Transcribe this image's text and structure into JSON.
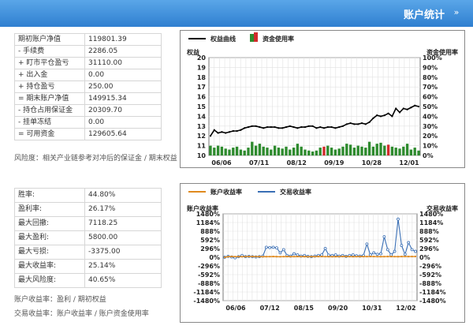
{
  "header": {
    "title": "账户统计",
    "toggle_glyph": "»"
  },
  "account_table": [
    {
      "label": "期初账户净值",
      "value": "119801.39"
    },
    {
      "label": "- 手续费",
      "value": "2286.05"
    },
    {
      "label": "+ 盯市平仓盈亏",
      "value": "31110.00"
    },
    {
      "label": "+ 出入金",
      "value": "0.00"
    },
    {
      "label": "+ 持仓盈亏",
      "value": "250.00"
    },
    {
      "label": "= 期末账户净值",
      "value": "149915.34"
    },
    {
      "label": "- 持仓占用保证金",
      "value": "20309.70"
    },
    {
      "label": "- 挂单冻结",
      "value": "0.00"
    },
    {
      "label": "= 可用资金",
      "value": "129605.64"
    }
  ],
  "risk_note": "风险度：相关产业链参考对冲后的保证金 / 期末权益",
  "performance_table": [
    {
      "label": "胜率:",
      "value": "44.80%"
    },
    {
      "label": "盈利率:",
      "value": "26.17%"
    },
    {
      "label": "最大回撤:",
      "value": "7118.25"
    },
    {
      "label": "最大盈利:",
      "value": "5800.00"
    },
    {
      "label": "最大亏损:",
      "value": "-3375.00"
    },
    {
      "label": "最大收益率:",
      "value": "25.14%"
    },
    {
      "label": "最大风险度:",
      "value": "40.65%"
    }
  ],
  "formula_notes": {
    "account_return": "账户收益率：盈利 / 期初权益",
    "trade_return": "交易收益率：账户收益率 / 账户资金使用率"
  },
  "colors": {
    "equity_line": "#000000",
    "usage_up": "#2e8b2e",
    "usage_down": "#d12c2c",
    "account_line": "#e08a1e",
    "trade_line": "#3a6fb5"
  },
  "chart_data": [
    {
      "type": "line+bar",
      "legend": [
        {
          "name": "权益曲线",
          "icon": "line"
        },
        {
          "name": "资金使用率",
          "icon": "bar-green-red"
        }
      ],
      "left_axis_title": "权益",
      "right_axis_title": "资金使用率",
      "left_ticks": [
        "20",
        "19",
        "18",
        "17",
        "16",
        "15",
        "14",
        "13",
        "12",
        "11",
        "10"
      ],
      "right_ticks": [
        "100%",
        "90%",
        "80%",
        "70%",
        "60%",
        "50%",
        "40%",
        "30%",
        "20%",
        "10%",
        "0%"
      ],
      "x_ticks": [
        "06/06",
        "07/11",
        "08/12",
        "09/19",
        "10/28",
        "12/01"
      ],
      "ylim": [
        10,
        20
      ],
      "equity": [
        12.0,
        12.6,
        12.3,
        12.4,
        12.3,
        12.4,
        12.5,
        12.5,
        12.6,
        12.8,
        12.9,
        13.0,
        13.0,
        12.9,
        12.8,
        12.9,
        12.9,
        12.9,
        12.8,
        12.8,
        12.9,
        13.0,
        12.9,
        12.8,
        12.9,
        12.9,
        13.0,
        13.0,
        12.8,
        12.9,
        12.8,
        12.9,
        12.9,
        12.8,
        12.9,
        13.0,
        13.2,
        13.3,
        13.2,
        13.2,
        13.3,
        13.2,
        13.4,
        13.8,
        14.1,
        14.0,
        14.1,
        14.3,
        14.0,
        14.8,
        14.4,
        14.8,
        14.7,
        14.9,
        15.1,
        15.0
      ],
      "usage": [
        10,
        8,
        10,
        9,
        7,
        6,
        8,
        9,
        6,
        5,
        8,
        14,
        10,
        12,
        9,
        8,
        6,
        10,
        8,
        7,
        9,
        6,
        8,
        12,
        9,
        6,
        5,
        4,
        5,
        8,
        9,
        10,
        8,
        6,
        7,
        9,
        12,
        11,
        8,
        10,
        9,
        8,
        14,
        9,
        12,
        13,
        10,
        11,
        9,
        8,
        7,
        9,
        12,
        6,
        8,
        5
      ],
      "usage_negative_idx": [
        30,
        47
      ]
    },
    {
      "type": "line",
      "legend": [
        {
          "name": "账户收益率",
          "color": "#e08a1e"
        },
        {
          "name": "交易收益率",
          "color": "#3a6fb5"
        }
      ],
      "left_axis_title": "账户收益率",
      "right_axis_title": "交易收益率",
      "left_ticks": [
        "1480%",
        "1184%",
        "888%",
        "592%",
        "296%",
        "0%",
        "-296%",
        "-592%",
        "-888%",
        "-1184%",
        "-1480%"
      ],
      "right_ticks": [
        "1480%",
        "1184%",
        "888%",
        "592%",
        "296%",
        "0%",
        "-296%",
        "-592%",
        "-888%",
        "-1184%",
        "-1480%"
      ],
      "x_ticks": [
        "06/06",
        "07/12",
        "08/15",
        "09/20",
        "10/31",
        "12/02"
      ],
      "ylim": [
        -1480,
        1480
      ],
      "account_return": [
        0,
        20,
        25,
        22,
        20,
        18,
        22,
        25,
        24,
        22,
        20,
        18,
        20,
        22,
        25,
        20,
        18,
        22,
        24,
        20,
        22,
        25,
        22,
        20,
        18,
        20,
        22,
        24,
        25,
        22,
        20,
        18,
        20,
        22,
        25,
        24,
        22,
        20,
        22,
        25,
        22,
        24,
        26,
        25,
        22,
        20,
        22,
        25,
        24,
        22,
        20,
        25,
        26,
        24,
        25,
        26
      ],
      "trade_return": [
        0,
        30,
        10,
        -20,
        20,
        60,
        20,
        30,
        20,
        10,
        20,
        40,
        340,
        330,
        340,
        320,
        150,
        260,
        60,
        40,
        120,
        80,
        40,
        60,
        30,
        20,
        40,
        60,
        80,
        300,
        70,
        60,
        80,
        40,
        60,
        30,
        60,
        80,
        50,
        40,
        60,
        450,
        80,
        150,
        100,
        120,
        700,
        260,
        80,
        200,
        1300,
        400,
        100,
        500,
        260,
        200
      ]
    }
  ]
}
